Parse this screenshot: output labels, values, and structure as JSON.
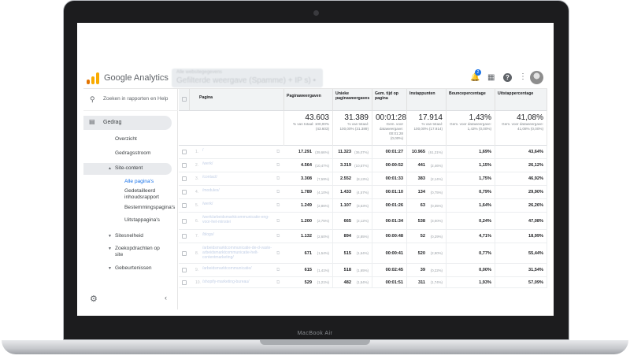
{
  "device": {
    "brand": "MacBook Air"
  },
  "app": {
    "name": "Google Analytics",
    "property_blurred_line1": "Alle websitegegevens",
    "property_blurred_line2": "Gefilterde weergave (Spamme) + IP s) •",
    "notification_count": "2"
  },
  "sidebar": {
    "search_label": "Zoeken in rapporten en Help",
    "section": "Gedrag",
    "items": [
      "Overzicht",
      "Gedragsstroom"
    ],
    "site_content": "Site-content",
    "site_content_items": [
      "Alle pagina's",
      "Gedetailleerd inhoudsrapport",
      "Bestemmingspagina's",
      "Uitstappagina's"
    ],
    "other_sections": [
      "Sitesnelheid",
      "Zoekopdrachten op site",
      "Gebeurtenissen"
    ]
  },
  "table": {
    "headers": [
      "Pagina",
      "Paginaweergaven",
      "Unieke paginaweergaves",
      "Gem. tijd op pagina",
      "Instappunten",
      "Bouncepercentage",
      "Uitstappercentage"
    ],
    "totals": [
      {
        "big": "43.603",
        "small": "% van totaal: 100,00% (43.603)"
      },
      {
        "big": "31.389",
        "small": "% van totaal: 100,00% (31.389)"
      },
      {
        "big": "00:01:28",
        "small": "Gem. voor dataweergave: 00:01:28 (0,00%)"
      },
      {
        "big": "17.914",
        "small": "% van totaal: 100,00% (17.914)"
      },
      {
        "big": "1,43%",
        "small": "Gem. voor dataweergave: 1,43% (0,00%)"
      },
      {
        "big": "41,08%",
        "small": "Gem. voor dataweergave: 41,08% (0,00%)"
      }
    ],
    "rows": [
      {
        "n": "1.",
        "page": "/",
        "pv": "17.291",
        "pvp": "(39,66%)",
        "upv": "11.323",
        "upvp": "(36,07%)",
        "time": "00:01:27",
        "ent": "10.965",
        "entp": "(61,21%)",
        "bounce": "1,69%",
        "exit": "43,64%"
      },
      {
        "n": "2.",
        "page": "/werk/",
        "pv": "4.564",
        "pvp": "(10,47%)",
        "upv": "3.319",
        "upvp": "(10,57%)",
        "time": "00:00:52",
        "ent": "441",
        "entp": "(2,46%)",
        "bounce": "1,15%",
        "exit": "26,12%"
      },
      {
        "n": "3.",
        "page": "/contact/",
        "pv": "3.308",
        "pvp": "(7,59%)",
        "upv": "2.552",
        "upvp": "(8,13%)",
        "time": "00:01:33",
        "ent": "383",
        "entp": "(2,14%)",
        "bounce": "1,75%",
        "exit": "46,92%"
      },
      {
        "n": "4.",
        "page": "/modules/",
        "pv": "1.789",
        "pvp": "(4,10%)",
        "upv": "1.433",
        "upvp": "(4,57%)",
        "time": "00:01:10",
        "ent": "134",
        "entp": "(0,75%)",
        "bounce": "0,79%",
        "exit": "29,90%"
      },
      {
        "n": "5.",
        "page": "/werk/",
        "pv": "1.249",
        "pvp": "(2,86%)",
        "upv": "1.107",
        "upvp": "(3,53%)",
        "time": "00:01:26",
        "ent": "63",
        "entp": "(0,35%)",
        "bounce": "1,64%",
        "exit": "26,26%"
      },
      {
        "n": "6.",
        "page": "/werk/arbeidsmarktcommunicatie-eng-voor-het-minstei",
        "pv": "1.200",
        "pvp": "(2,75%)",
        "upv": "665",
        "upvp": "(2,12%)",
        "time": "00:01:34",
        "ent": "538",
        "entp": "(3,00%)",
        "bounce": "0,24%",
        "exit": "47,08%"
      },
      {
        "n": "7.",
        "page": "/blogs/",
        "pv": "1.132",
        "pvp": "(2,60%)",
        "upv": "894",
        "upvp": "(2,85%)",
        "time": "00:00:48",
        "ent": "52",
        "entp": "(0,29%)",
        "bounce": "4,71%",
        "exit": "18,99%"
      },
      {
        "n": "8.",
        "page": "/arbeidsmarktcommunicatie-de-d-vaste-arbeidsmarktcommunicatie-helt-contentmarketing/",
        "pv": "671",
        "pvp": "(1,54%)",
        "upv": "515",
        "upvp": "(1,64%)",
        "time": "00:00:41",
        "ent": "520",
        "entp": "(2,90%)",
        "bounce": "0,77%",
        "exit": "55,44%"
      },
      {
        "n": "9.",
        "page": "/arbeidsmarktcommunicatie/",
        "pv": "615",
        "pvp": "(1,41%)",
        "upv": "518",
        "upvp": "(1,65%)",
        "time": "00:02:45",
        "ent": "39",
        "entp": "(0,22%)",
        "bounce": "0,00%",
        "exit": "31,54%"
      },
      {
        "n": "10.",
        "page": "/shopify-marketing-bureau/",
        "pv": "529",
        "pvp": "(1,21%)",
        "upv": "482",
        "upvp": "(1,54%)",
        "time": "00:01:51",
        "ent": "311",
        "entp": "(1,74%)",
        "bounce": "1,93%",
        "exit": "57,09%"
      }
    ]
  },
  "colors": {
    "accent": "#1a73e8",
    "logo_orange": "#f9ab00",
    "logo_dark": "#e37400"
  }
}
